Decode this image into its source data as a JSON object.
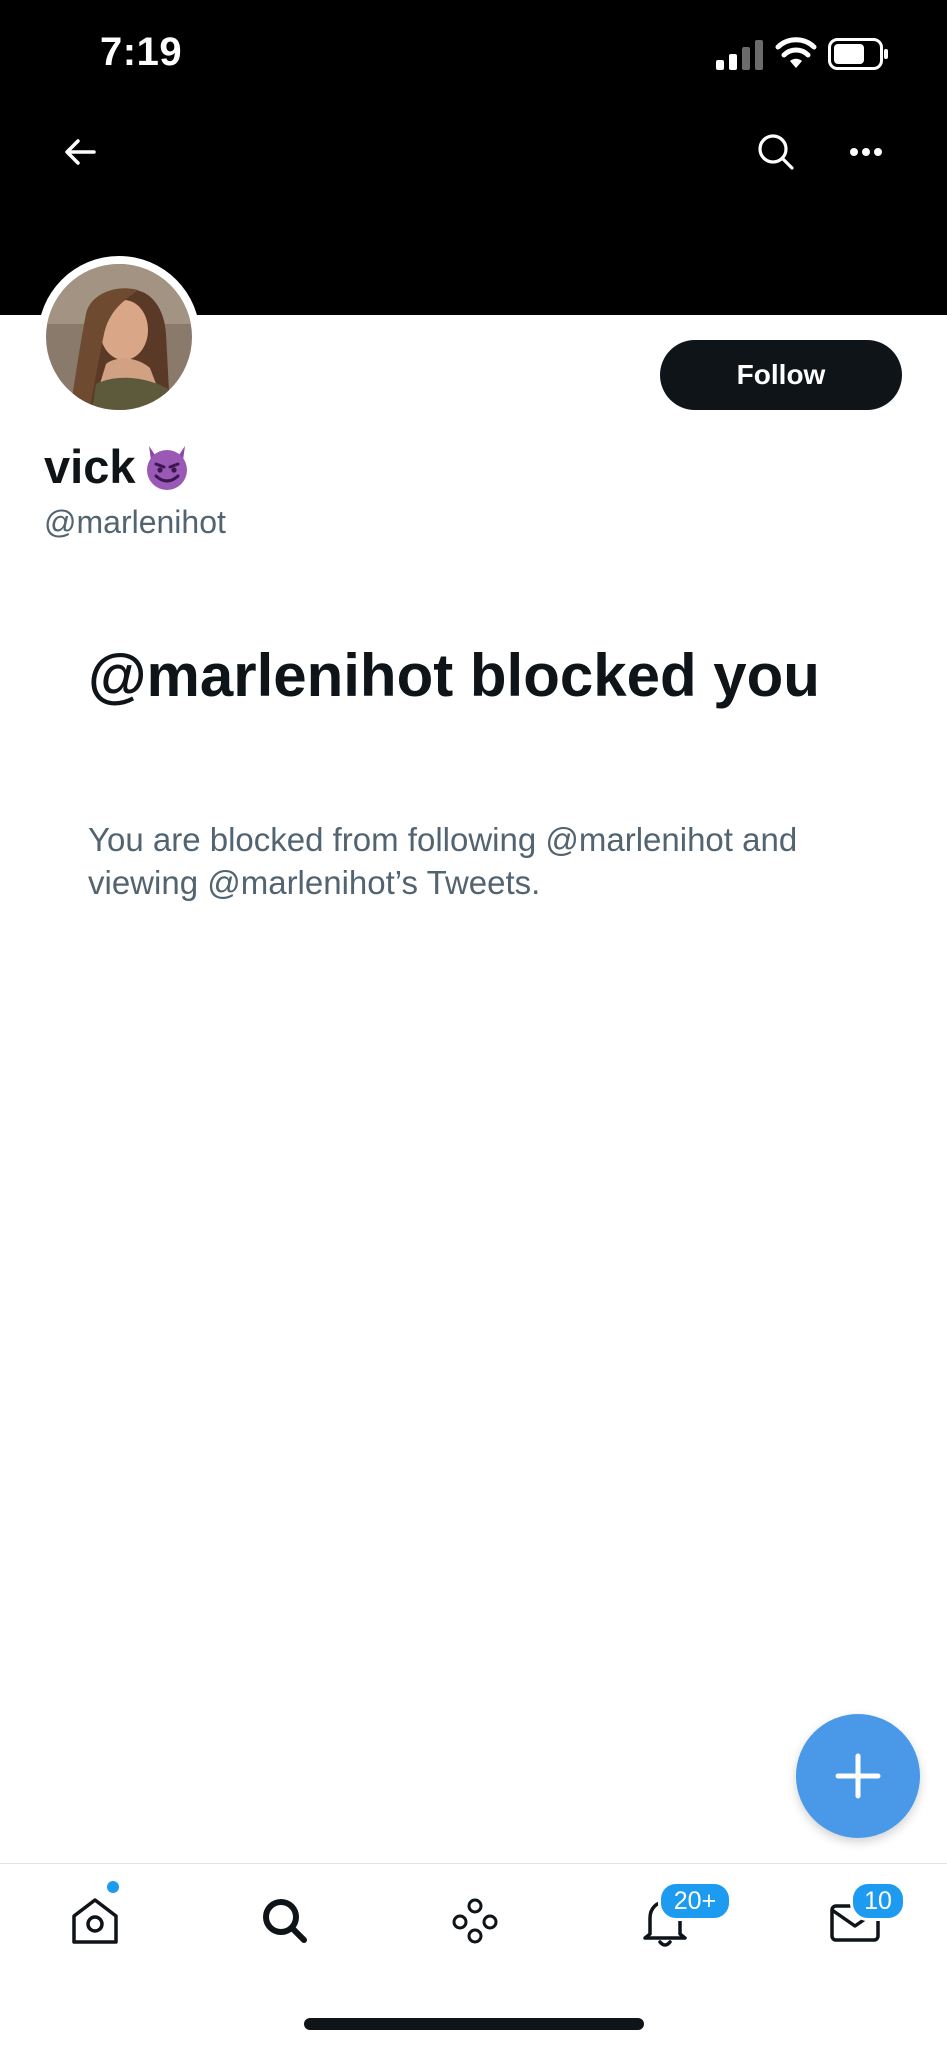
{
  "status_bar": {
    "time": "7:19"
  },
  "profile": {
    "display_name": "vick",
    "handle": "@marlenihot",
    "follow_label": "Follow"
  },
  "blocked": {
    "title": "@marlenihot blocked you",
    "description": "You are blocked from following @marlenihot and viewing @marlenihot’s Tweets."
  },
  "tab_bar": {
    "notifications_badge": "20+",
    "messages_badge": "10"
  },
  "colors": {
    "accent": "#1d9bf0",
    "fab": "#4a99e9",
    "text_primary": "#0f1419",
    "text_secondary": "#536471"
  }
}
